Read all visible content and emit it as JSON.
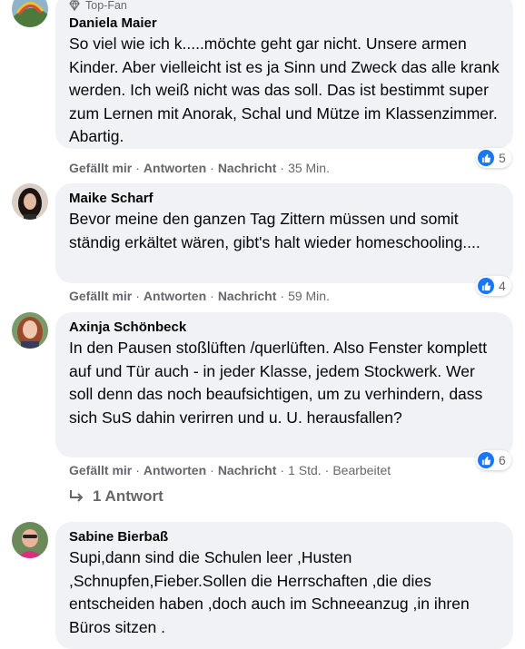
{
  "comments": [
    {
      "badge": "Top-Fan",
      "author": "Daniela Maier",
      "text": "So viel wie ich k.....möchte geht gar nicht. Unsere armen Kinder. Aber vielleicht ist es ja Sinn und Zweck das alle krank werden. Ich weiß nicht was das soll. Das ist bestimmt super zum Lernen mit Anorak, Schal und Mütze im Klassenzimmer. Abartig.",
      "like_label": "Gefällt mir",
      "reply_label": "Antworten",
      "message_label": "Nachricht",
      "time": "35 Min.",
      "reactions": "5"
    },
    {
      "author": "Maike Scharf",
      "text": "Bevor meine den ganzen Tag Zittern müssen und somit ständig erkältet wären, gibt's halt wieder homeschooling....",
      "like_label": "Gefällt mir",
      "reply_label": "Antworten",
      "message_label": "Nachricht",
      "time": "59 Min.",
      "reactions": "4"
    },
    {
      "author": "Axinja Schönbeck",
      "text": "In den Pausen stoßlüften /querlüften. Also Fenster komplett auf und Tür auch - in jeder Klasse, jedem Stockwerk. Wer soll denn das noch beaufsichtigen, um zu verhindern, dass sich SuS dahin verirren und u. U. herausfallen?",
      "like_label": "Gefällt mir",
      "reply_label": "Antworten",
      "message_label": "Nachricht",
      "time": "1 Std.",
      "edited": "Bearbeitet",
      "reactions": "6",
      "replies": "1 Antwort"
    },
    {
      "author": "Sabine Bierbaß",
      "text": "Supi,dann sind die Schulen leer ,Husten ,Schnupfen,Fieber.Sollen die Herrschaften ,die dies entscheiden haben ,doch auch im Schneeanzug ,in ihren Büros sitzen ."
    }
  ],
  "separator": "·",
  "colors": {
    "bubble": "#f0f2f5",
    "meta": "#65676b",
    "like": "#1877f2"
  }
}
